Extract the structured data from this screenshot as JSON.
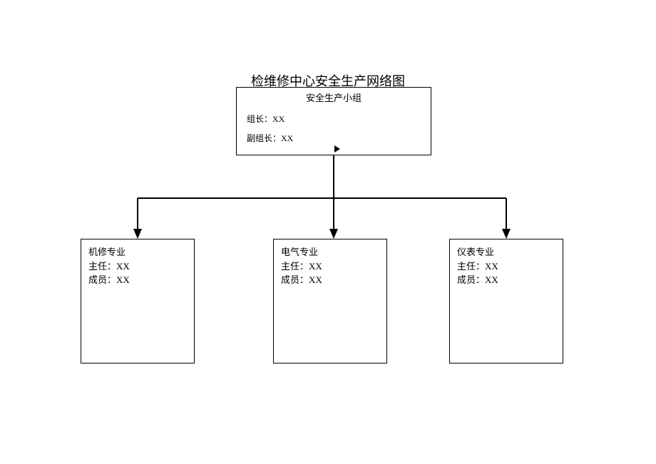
{
  "title": "检维修中心安全生产网络图",
  "topBox": {
    "header": "安全生产小组",
    "leaderLabel": "组长：",
    "leaderValue": "XX",
    "deputyLabel": "副组长：",
    "deputyValue": "XX"
  },
  "children": [
    {
      "name": "机修专业",
      "directorLabel": "主任：",
      "directorValue": "XX",
      "memberLabel": "成员：",
      "memberValue": "XX"
    },
    {
      "name": "电气专业",
      "directorLabel": "主任：",
      "directorValue": "XX",
      "memberLabel": "成员：",
      "memberValue": "XX"
    },
    {
      "name": "仪表专业",
      "directorLabel": "主任：",
      "directorValue": "XX",
      "memberLabel": "成员：",
      "memberValue": "XX"
    }
  ]
}
